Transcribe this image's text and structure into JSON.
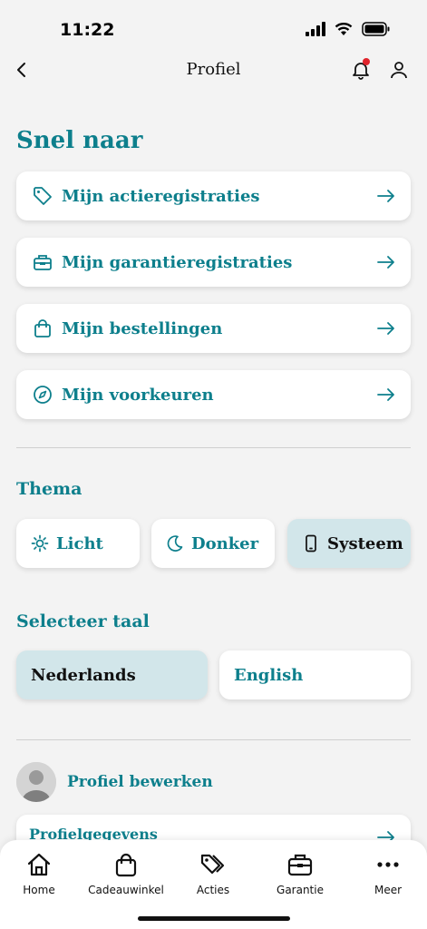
{
  "status_bar": {
    "time": "11:22"
  },
  "header": {
    "title": "Profiel"
  },
  "quick_links": {
    "title": "Snel naar",
    "items": [
      {
        "label": "Mijn actieregistraties",
        "icon": "tag-icon"
      },
      {
        "label": "Mijn garantieregistraties",
        "icon": "toolbox-icon"
      },
      {
        "label": "Mijn bestellingen",
        "icon": "shopping-bag-icon"
      },
      {
        "label": "Mijn voorkeuren",
        "icon": "compass-icon"
      }
    ]
  },
  "theme": {
    "title": "Thema",
    "options": [
      {
        "label": "Licht",
        "icon": "sun-icon",
        "selected": false
      },
      {
        "label": "Donker",
        "icon": "moon-icon",
        "selected": false
      },
      {
        "label": "Systeem",
        "icon": "phone-icon",
        "selected": true
      }
    ]
  },
  "language": {
    "title": "Selecteer taal",
    "options": [
      {
        "label": "Nederlands",
        "selected": true
      },
      {
        "label": "English",
        "selected": false
      }
    ]
  },
  "profile": {
    "edit_label": "Profiel bewerken",
    "first_item": "Profielgegevens"
  },
  "tabbar": {
    "items": [
      {
        "label": "Home",
        "icon": "home-icon"
      },
      {
        "label": "Cadeauwinkel",
        "icon": "shopping-bag-icon"
      },
      {
        "label": "Acties",
        "icon": "tags-icon"
      },
      {
        "label": "Garantie",
        "icon": "briefcase-icon"
      },
      {
        "label": "Meer",
        "icon": "more-icon"
      }
    ]
  },
  "colors": {
    "accent": "#0d7f8c",
    "selected_bg": "#d2e6ea",
    "background": "#f3f3f3"
  }
}
